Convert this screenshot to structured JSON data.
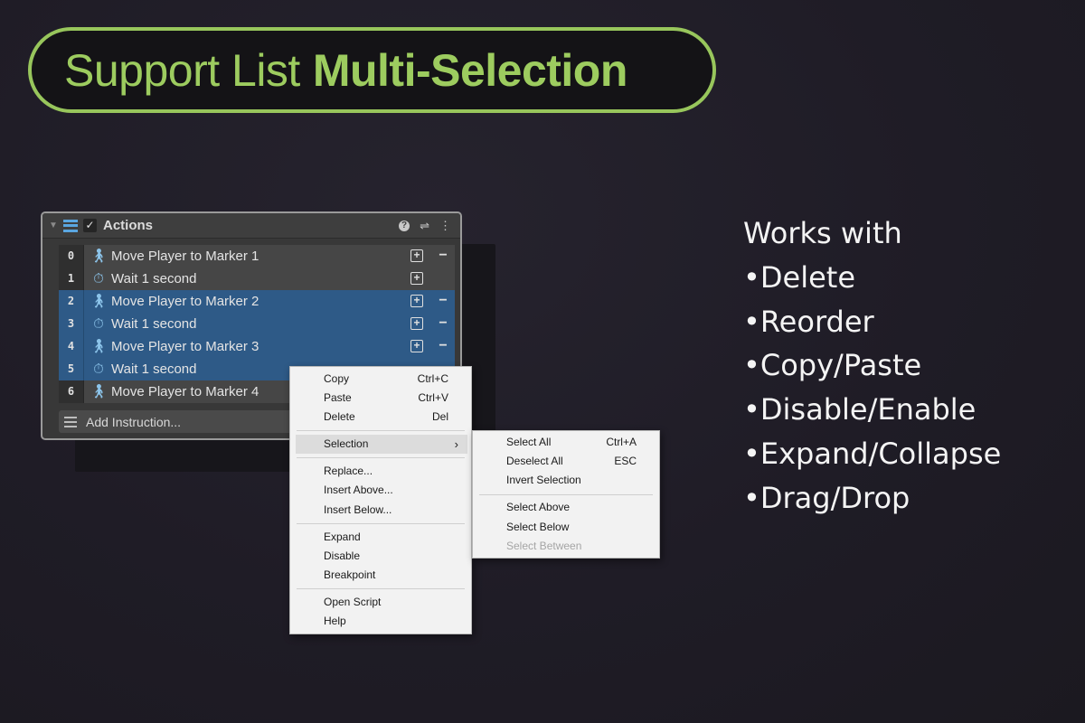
{
  "headline": {
    "light": "Support List",
    "bold": "Multi-Selection"
  },
  "panel": {
    "title": "Actions",
    "collapse_icon": "triangle-down-icon",
    "list_icon": "list-icon",
    "enabled_checked": true,
    "header_icons": [
      "help-icon",
      "settings-sliders-icon",
      "more-vert-icon"
    ],
    "rows": [
      {
        "index": "0",
        "icon": "walk-icon",
        "label": "Move Player to Marker 1",
        "selected": false
      },
      {
        "index": "1",
        "icon": "timer-icon",
        "label": "Wait 1 second",
        "selected": false
      },
      {
        "index": "2",
        "icon": "walk-icon",
        "label": "Move Player to Marker 2",
        "selected": true
      },
      {
        "index": "3",
        "icon": "timer-icon",
        "label": "Wait 1 second",
        "selected": true
      },
      {
        "index": "4",
        "icon": "walk-icon",
        "label": "Move Player to Marker 3",
        "selected": true
      },
      {
        "index": "5",
        "icon": "timer-icon",
        "label": "Wait 1 second",
        "selected": true
      },
      {
        "index": "6",
        "icon": "walk-icon",
        "label": "Move Player to Marker 4",
        "selected": false
      }
    ],
    "add_instruction": "Add Instruction..."
  },
  "context_menu": {
    "copy": {
      "label": "Copy",
      "shortcut": "Ctrl+C"
    },
    "paste": {
      "label": "Paste",
      "shortcut": "Ctrl+V"
    },
    "delete": {
      "label": "Delete",
      "shortcut": "Del"
    },
    "selection": {
      "label": "Selection",
      "arrow": "›"
    },
    "replace": "Replace...",
    "insert_above": "Insert Above...",
    "insert_below": "Insert Below...",
    "expand": "Expand",
    "disable": "Disable",
    "breakpoint": "Breakpoint",
    "open_script": "Open Script",
    "help": "Help"
  },
  "selection_submenu": {
    "select_all": {
      "label": "Select All",
      "shortcut": "Ctrl+A"
    },
    "deselect_all": {
      "label": "Deselect All",
      "shortcut": "ESC"
    },
    "invert_selection": "Invert Selection",
    "select_above": "Select Above",
    "select_below": "Select Below",
    "select_between": "Select Between"
  },
  "works_with": {
    "heading": "Works with",
    "items": [
      "•Delete",
      "•Reorder",
      "•Copy/Paste",
      "•Disable/Enable",
      "•Expand/Collapse",
      "•Drag/Drop"
    ]
  },
  "colors": {
    "accent_green": "#9dcc5f",
    "selection_blue": "#2e5a87",
    "icon_blue": "#8cc4ea"
  }
}
